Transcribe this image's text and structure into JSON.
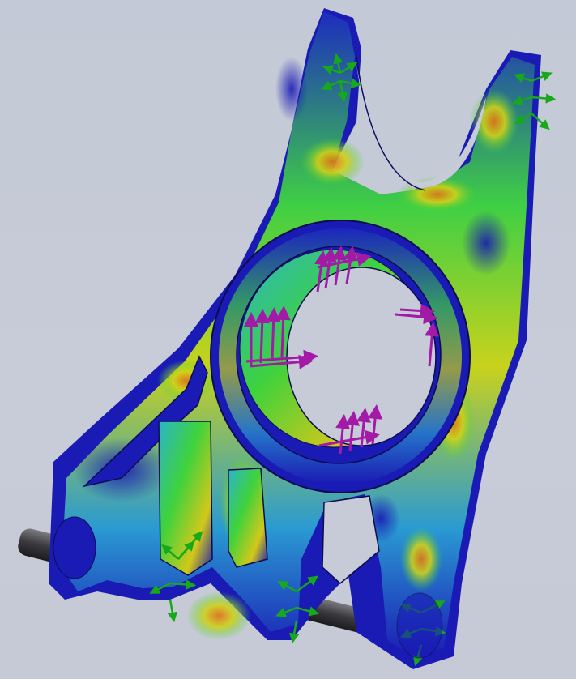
{
  "viewport": {
    "background_color": "#c6cbd7",
    "model": "bracket-part",
    "display_mode": "stress-plot"
  },
  "colors": {
    "low_stress": "#1a1ab4",
    "mid_low": "#2cc0c8",
    "mid": "#3fd23c",
    "mid_high": "#c9d418",
    "high": "#e27a14",
    "load_arrow": "#a21aa6",
    "fixture_arrow": "#18a81c",
    "shaft": "#4a4a4d"
  },
  "markers": {
    "load": "force-arrow-icon",
    "fixture": "fixed-geometry-icon"
  }
}
